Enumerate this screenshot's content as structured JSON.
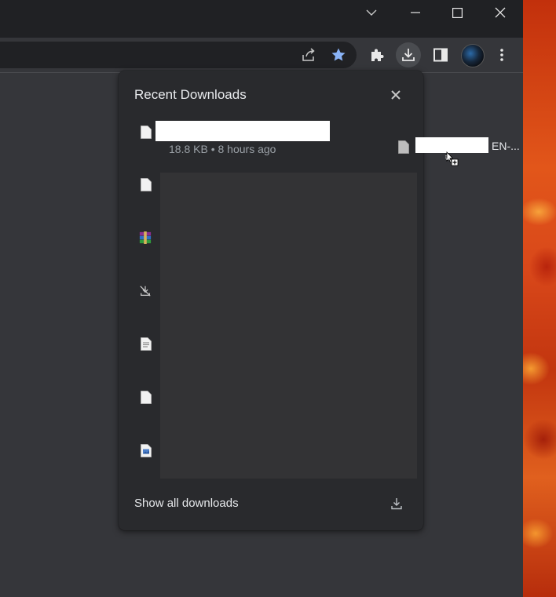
{
  "window_controls": {
    "tab_search_icon": "chevron-down-icon",
    "minimize_icon": "minimize-icon",
    "maximize_icon": "maximize-icon",
    "close_icon": "close-icon"
  },
  "toolbar": {
    "icons": [
      "share-icon",
      "bookmark-star-icon",
      "extensions-icon",
      "download-icon",
      "side-panel-icon",
      "profile-avatar",
      "menu-icon"
    ],
    "bookmark_color": "#8ab4f8"
  },
  "downloads_bubble": {
    "title": "Recent Downloads",
    "items": [
      {
        "icon": "document-icon",
        "meta": "18.8 KB • 8 hours ago"
      },
      {
        "icon": "document-icon"
      },
      {
        "icon": "winrar-archive-icon"
      },
      {
        "icon": "blocked-download-icon"
      },
      {
        "icon": "text-document-icon"
      },
      {
        "icon": "document-icon"
      },
      {
        "icon": "image-document-icon"
      }
    ],
    "footer_label": "Show all downloads"
  },
  "drag_ghost": {
    "icon": "document-icon",
    "label": "EN-..."
  },
  "colors": {
    "titlebar": "#202124",
    "toolbar": "#35363a",
    "bubble": "#292a2d",
    "text": "#e8eaed",
    "secondary_text": "#9aa0a6"
  }
}
